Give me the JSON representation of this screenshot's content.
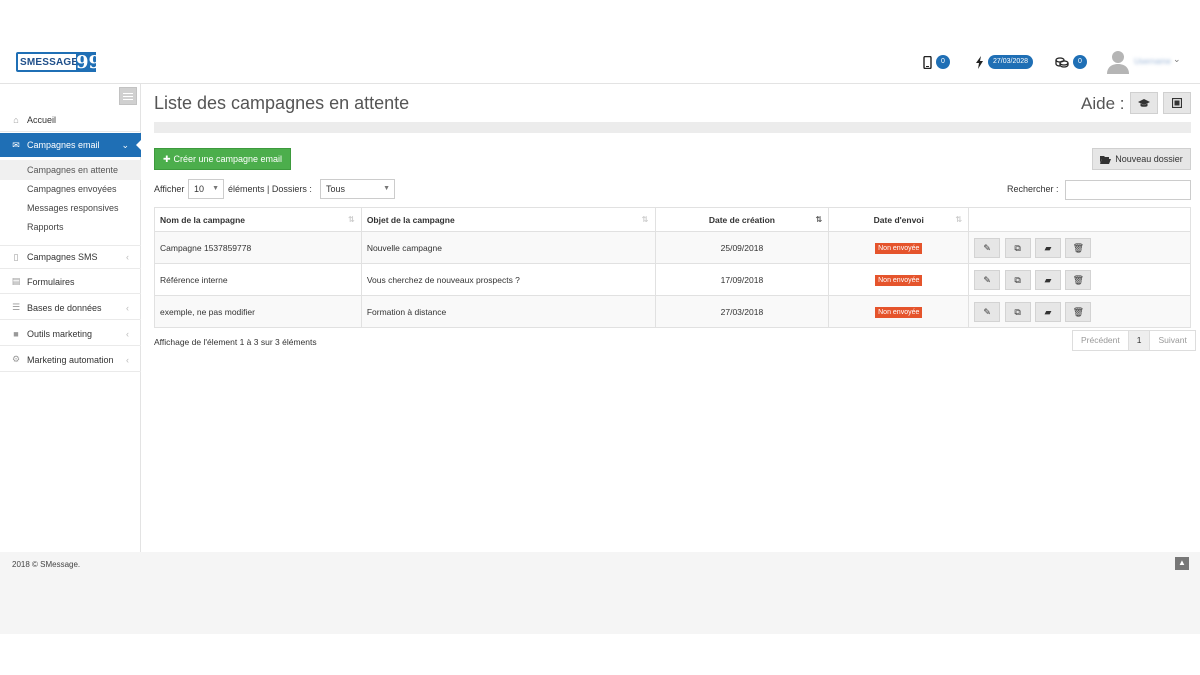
{
  "brand": {
    "name": "SMESSAGE",
    "quote_glyph": "99"
  },
  "header": {
    "phone_count": "0",
    "date_badge": "27/03/2028",
    "credits_count": "0",
    "username": "Username"
  },
  "sidebar": {
    "items": [
      {
        "label": "Accueil",
        "icon": "home-icon"
      },
      {
        "label": "Campagnes email",
        "icon": "envelope-icon"
      },
      {
        "label": "Campagnes SMS",
        "icon": "mobile-icon"
      },
      {
        "label": "Formulaires",
        "icon": "list-icon"
      },
      {
        "label": "Bases de données",
        "icon": "list-ul-icon"
      },
      {
        "label": "Outils marketing",
        "icon": "video-icon"
      },
      {
        "label": "Marketing automation",
        "icon": "cogs-icon"
      }
    ],
    "subitems": [
      {
        "label": "Campagnes en attente"
      },
      {
        "label": "Campagnes envoyées"
      },
      {
        "label": "Messages responsives"
      },
      {
        "label": "Rapports"
      }
    ]
  },
  "main": {
    "title": "Liste des campagnes en attente",
    "help_label": "Aide :",
    "create_button": "Créer une campagne email",
    "new_folder_button": "Nouveau dossier",
    "show_label": "Afficher",
    "page_size": "10",
    "elements_label": "éléments | Dossiers :",
    "folder_filter": "Tous",
    "search_label": "Rechercher :",
    "search_value": ""
  },
  "table": {
    "columns": [
      "Nom de la campagne",
      "Objet de la campagne",
      "Date de création",
      "Date d'envoi"
    ],
    "rows": [
      {
        "name": "Campagne 1537859778",
        "subject": "Nouvelle campagne",
        "created": "25/09/2018",
        "status": "Non envoyée"
      },
      {
        "name": "Référence interne",
        "subject": "Vous cherchez de nouveaux prospects ?",
        "created": "17/09/2018",
        "status": "Non envoyée"
      },
      {
        "name": "exemple, ne pas modifier",
        "subject": "Formation à distance",
        "created": "27/03/2018",
        "status": "Non envoyée"
      }
    ]
  },
  "pagination": {
    "info": "Affichage de l'élement 1 à 3 sur 3 éléments",
    "prev": "Précédent",
    "page": "1",
    "next": "Suivant"
  },
  "footer": {
    "copyright": "2018 © SMessage."
  },
  "colors": {
    "primary": "#1f6fb5",
    "success": "#4cae4c",
    "danger": "#e5542c"
  }
}
